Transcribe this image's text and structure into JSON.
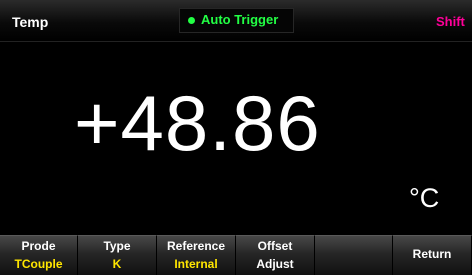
{
  "header": {
    "mode_title": "Temp",
    "trigger_label": "Auto Trigger",
    "shift_label": "Shift"
  },
  "measurement": {
    "value": "+48.86",
    "unit": "°C"
  },
  "softkeys": [
    {
      "label": "Prode",
      "value": "TCouple"
    },
    {
      "label": "Type",
      "value": "K"
    },
    {
      "label": "Reference",
      "value": "Internal"
    },
    {
      "label": "Offset",
      "value": "Adjust"
    },
    {
      "label": "",
      "value": ""
    },
    {
      "label": "Return",
      "value": ""
    }
  ],
  "colors": {
    "trigger": "#22ff44",
    "shift": "#ff0099",
    "softkey_value": "#ffe600"
  }
}
